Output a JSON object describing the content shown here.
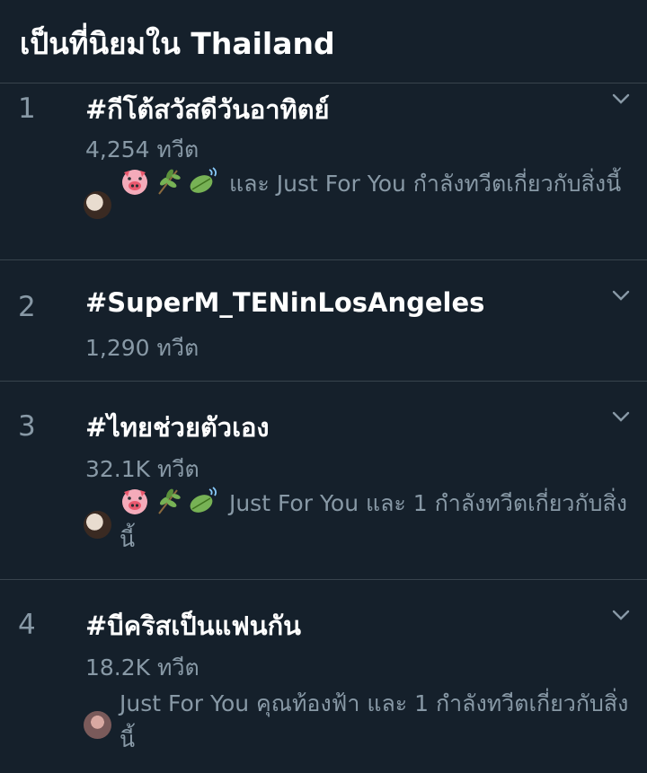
{
  "header": {
    "title": "เป็นที่นิยมใน Thailand"
  },
  "trends": [
    {
      "rank": "1",
      "hashtag": "#กีโต้สวัสดีวันอาทิตย์",
      "count": "4,254 ทวีต",
      "context": "และ Just For You กำลังทวีตเกี่ยวกับสิ่งนี้"
    },
    {
      "rank": "2",
      "hashtag": "#SuperM_TENinLosAngeles",
      "count": "1,290 ทวีต"
    },
    {
      "rank": "3",
      "hashtag": "#ไทยช่วยตัวเอง",
      "count": "32.1K ทวีต",
      "context": "Just For You และ 1 กำลังทวีตเกี่ยวกับสิ่งนี้"
    },
    {
      "rank": "4",
      "hashtag": "#บีคริสเป็นแฟนกัน",
      "count": "18.2K ทวีต",
      "context": "Just For You คุณท้องฟ้า และ 1 กำลังทวีตเกี่ยวกับสิ่งนี้"
    }
  ],
  "icons": {
    "chevron": "chevron-down-icon",
    "pig": "pig-face-icon",
    "herb": "herb-icon",
    "leaf": "leaf-fluttering-icon"
  },
  "colors": {
    "background": "#15202b",
    "divider": "#38444d",
    "secondary_text": "#8899a6"
  }
}
